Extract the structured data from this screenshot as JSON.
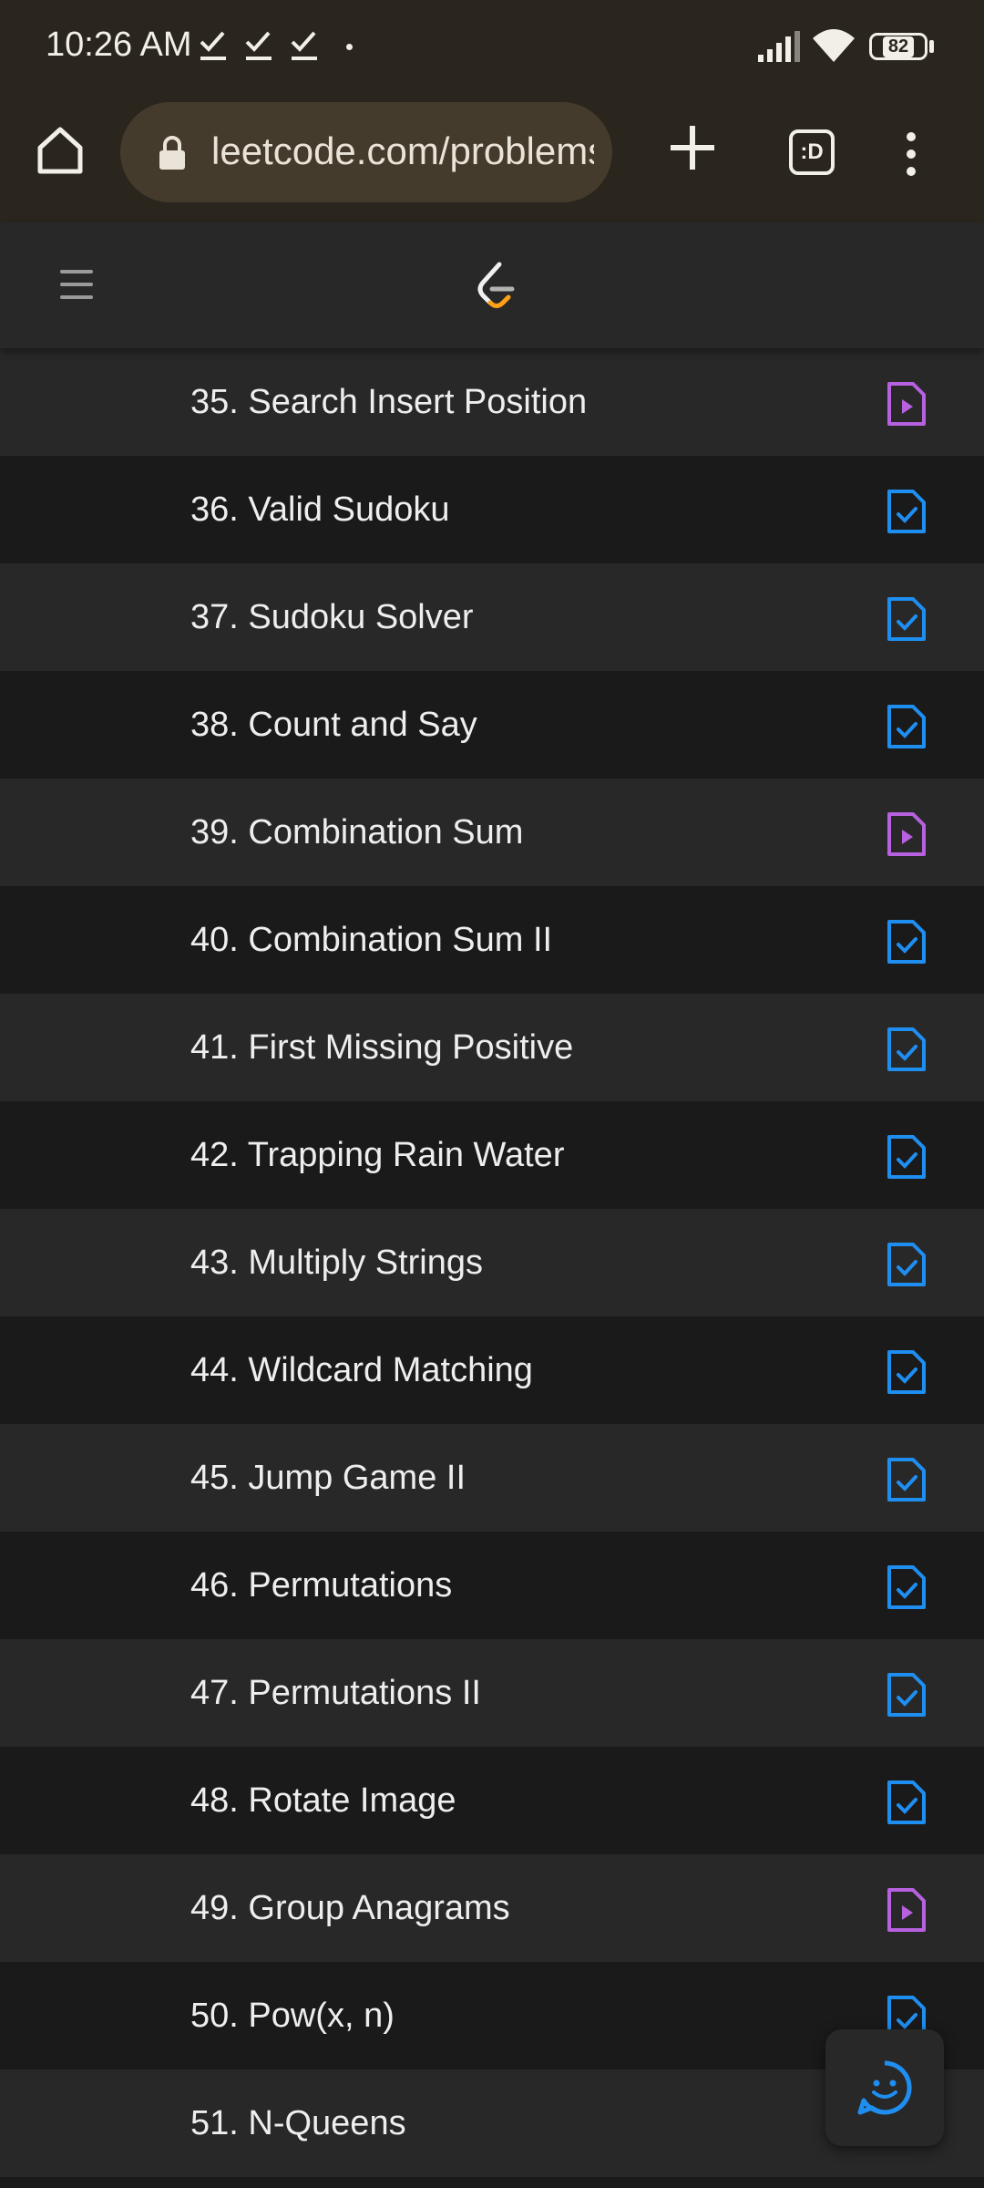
{
  "status_bar": {
    "time": "10:26 AM",
    "battery": "82"
  },
  "browser": {
    "url": "leetcode.com/problems"
  },
  "problems": [
    {
      "title": "35. Search Insert Position",
      "icon": "video-file-icon"
    },
    {
      "title": "36. Valid Sudoku",
      "icon": "solution-file-icon"
    },
    {
      "title": "37. Sudoku Solver",
      "icon": "solution-file-icon"
    },
    {
      "title": "38. Count and Say",
      "icon": "solution-file-icon"
    },
    {
      "title": "39. Combination Sum",
      "icon": "video-file-icon"
    },
    {
      "title": "40. Combination Sum II",
      "icon": "solution-file-icon"
    },
    {
      "title": "41. First Missing Positive",
      "icon": "solution-file-icon"
    },
    {
      "title": "42. Trapping Rain Water",
      "icon": "solution-file-icon"
    },
    {
      "title": "43. Multiply Strings",
      "icon": "solution-file-icon"
    },
    {
      "title": "44. Wildcard Matching",
      "icon": "solution-file-icon"
    },
    {
      "title": "45. Jump Game II",
      "icon": "solution-file-icon"
    },
    {
      "title": "46. Permutations",
      "icon": "solution-file-icon"
    },
    {
      "title": "47. Permutations II",
      "icon": "solution-file-icon"
    },
    {
      "title": "48. Rotate Image",
      "icon": "solution-file-icon"
    },
    {
      "title": "49. Group Anagrams",
      "icon": "video-file-icon"
    },
    {
      "title": "50. Pow(x, n)",
      "icon": "solution-file-icon"
    },
    {
      "title": "51. N-Queens",
      "icon": ""
    }
  ],
  "colors": {
    "solution_icon": "#1f8ef1",
    "video_icon": "#b760e0",
    "logo_orange": "#ffa116"
  }
}
